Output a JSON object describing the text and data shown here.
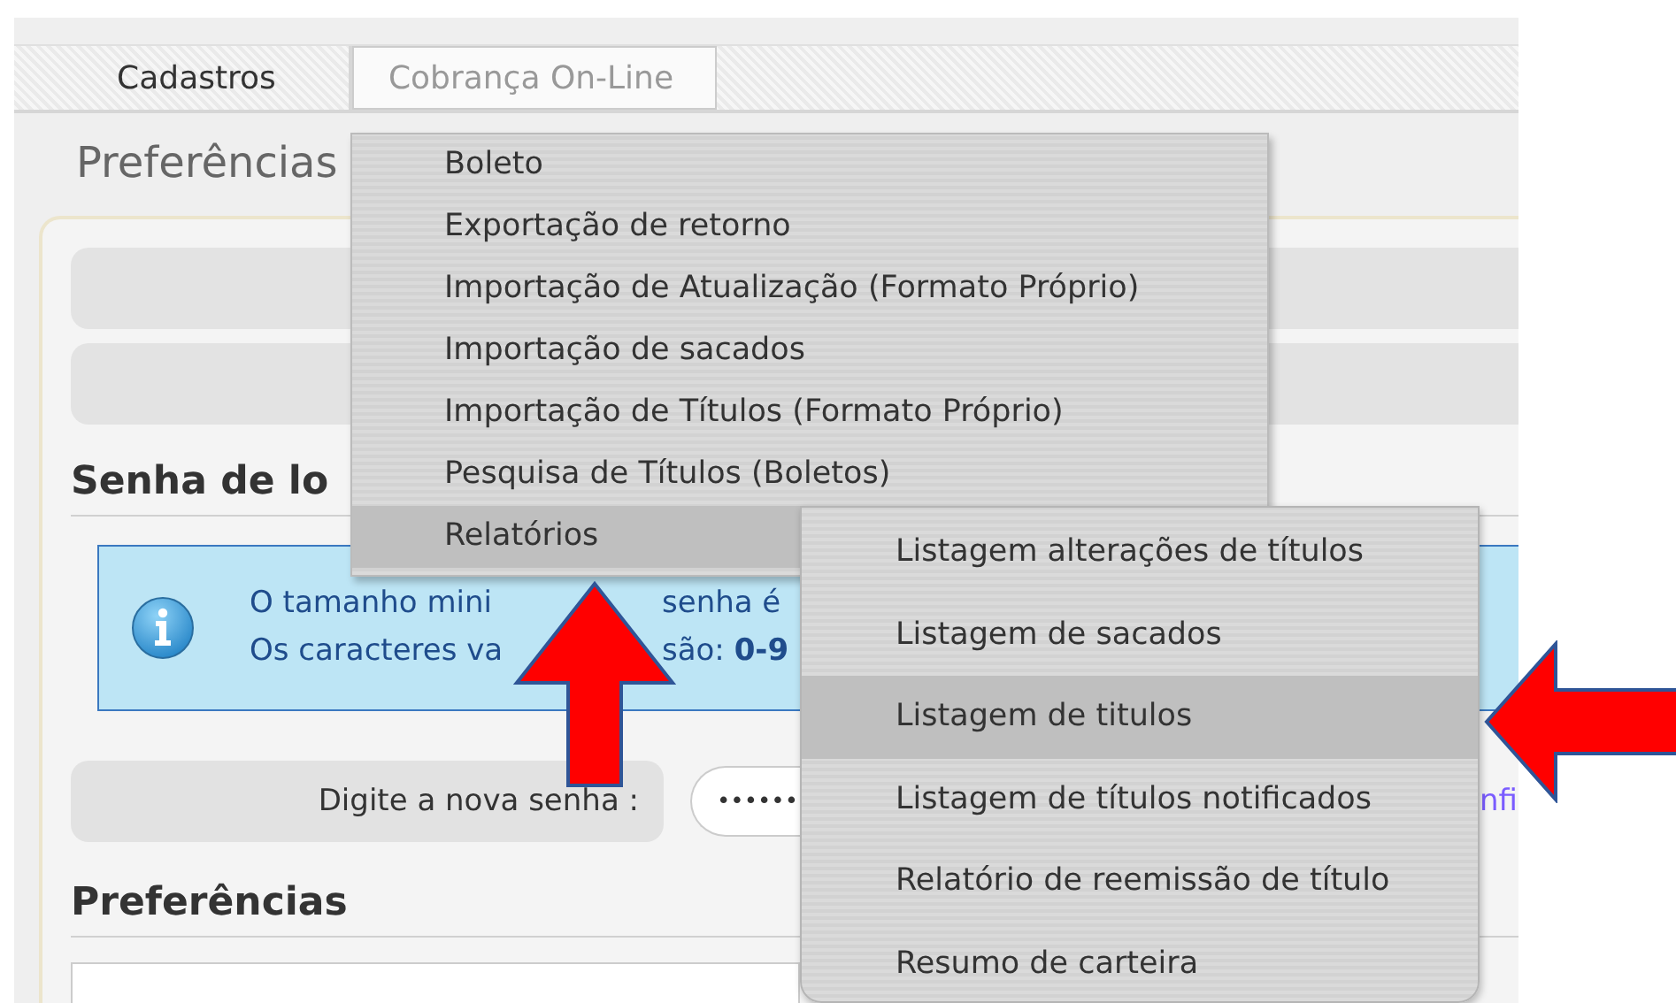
{
  "menu_bar": [
    {
      "label": "Cadastros",
      "open": false
    },
    {
      "label": "Cobrança On-Line",
      "open": true
    }
  ],
  "page_title": "Preferências",
  "section_title": "Senha de lo",
  "info": {
    "lines": [
      {
        "before": "O tamanho mini",
        "after": "senha é"
      },
      {
        "before": "Os caracteres va",
        "after": "são: **0-9**"
      }
    ]
  },
  "password": {
    "label": "Digite a nova senha :",
    "value": "••••••"
  },
  "link": "nfi",
  "section2_title": "Preferências",
  "dropdown": {
    "items": [
      {
        "label": "Boleto",
        "selected": false
      },
      {
        "label": "Exportação de retorno",
        "selected": false
      },
      {
        "label": "Importação de Atualização (Formato Próprio)",
        "selected": false
      },
      {
        "label": "Importação de sacados",
        "selected": false
      },
      {
        "label": "Importação de Títulos (Formato Próprio)",
        "selected": false
      },
      {
        "label": "Pesquisa de Títulos (Boletos)",
        "selected": false
      },
      {
        "label": "Relatórios",
        "selected": true
      }
    ]
  },
  "submenu": {
    "items": [
      {
        "label": "Listagem alterações de títulos",
        "selected": false
      },
      {
        "label": "Listagem de sacados",
        "selected": false
      },
      {
        "label": "Listagem de titulos",
        "selected": true
      },
      {
        "label": "Listagem de títulos notificados",
        "selected": false
      },
      {
        "label": "Relatório de reemissão de título",
        "selected": false
      },
      {
        "label": "Resumo de carteira",
        "selected": false
      }
    ]
  }
}
